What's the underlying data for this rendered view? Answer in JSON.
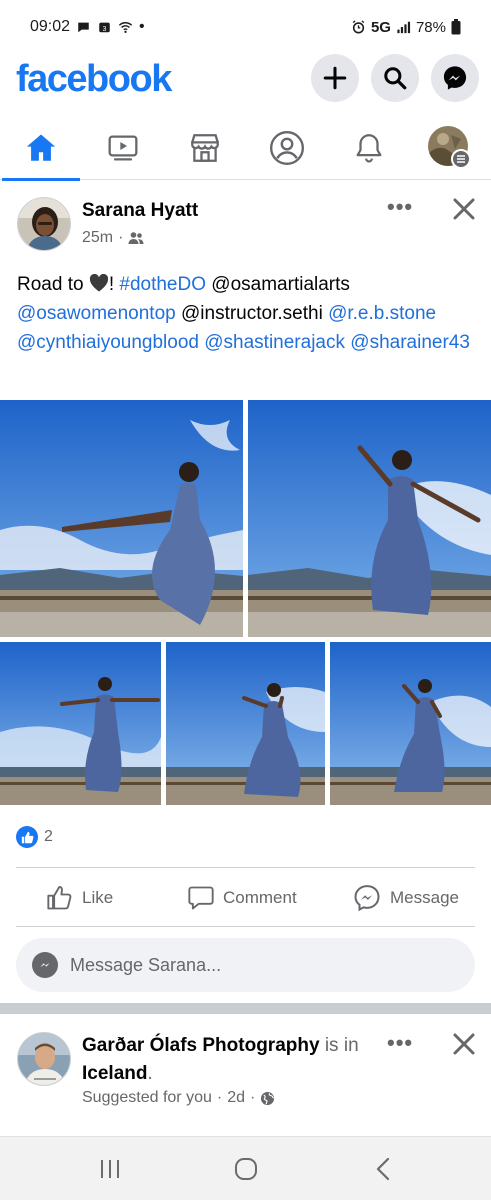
{
  "status_bar": {
    "time": "09:02",
    "network": "5G",
    "battery": "78%",
    "dot": "•"
  },
  "header": {
    "logo": "facebook",
    "buttons": [
      "plus-icon",
      "search-icon",
      "messenger-icon"
    ]
  },
  "nav_tabs": [
    {
      "name": "home",
      "icon": "home-icon",
      "active": true
    },
    {
      "name": "watch",
      "icon": "video-icon",
      "active": false
    },
    {
      "name": "marketplace",
      "icon": "store-icon",
      "active": false
    },
    {
      "name": "profile",
      "icon": "profile-icon",
      "active": false
    },
    {
      "name": "notifications",
      "icon": "bell-icon",
      "active": false
    },
    {
      "name": "menu",
      "icon": "avatar-menu-icon",
      "active": false
    }
  ],
  "post": {
    "author": "Sarana Hyatt",
    "time": "25m",
    "audience_icon": "friends-icon",
    "more_label": "•••",
    "text": {
      "prefix": "Road to ",
      "after_heart": "! ",
      "hashtag": "#dotheDO",
      "mention1": "@osamartialarts",
      "mention2": "@osawomenontop",
      "mention3": "@instructor.sethi",
      "mention4": "@r.e.b.stone",
      "mention5": "@cynthiaiyoungblood",
      "mention6": "@shastinerajack",
      "mention7": "@sharainer43"
    },
    "reaction_count": "2",
    "actions": {
      "like": "Like",
      "comment": "Comment",
      "message": "Message"
    },
    "message_placeholder": "Message Sarana..."
  },
  "post2": {
    "author": "Garðar Ólafs Photography",
    "is_in": "is",
    "in_word": "in",
    "location": "Iceland",
    "period": ".",
    "subtitle": "Suggested for you",
    "time": "2d",
    "more_label": "•••"
  },
  "colors": {
    "brand": "#1877f2",
    "link": "#216fdb",
    "secondary_text": "#65676b",
    "icon_bg": "#e4e6eb"
  }
}
